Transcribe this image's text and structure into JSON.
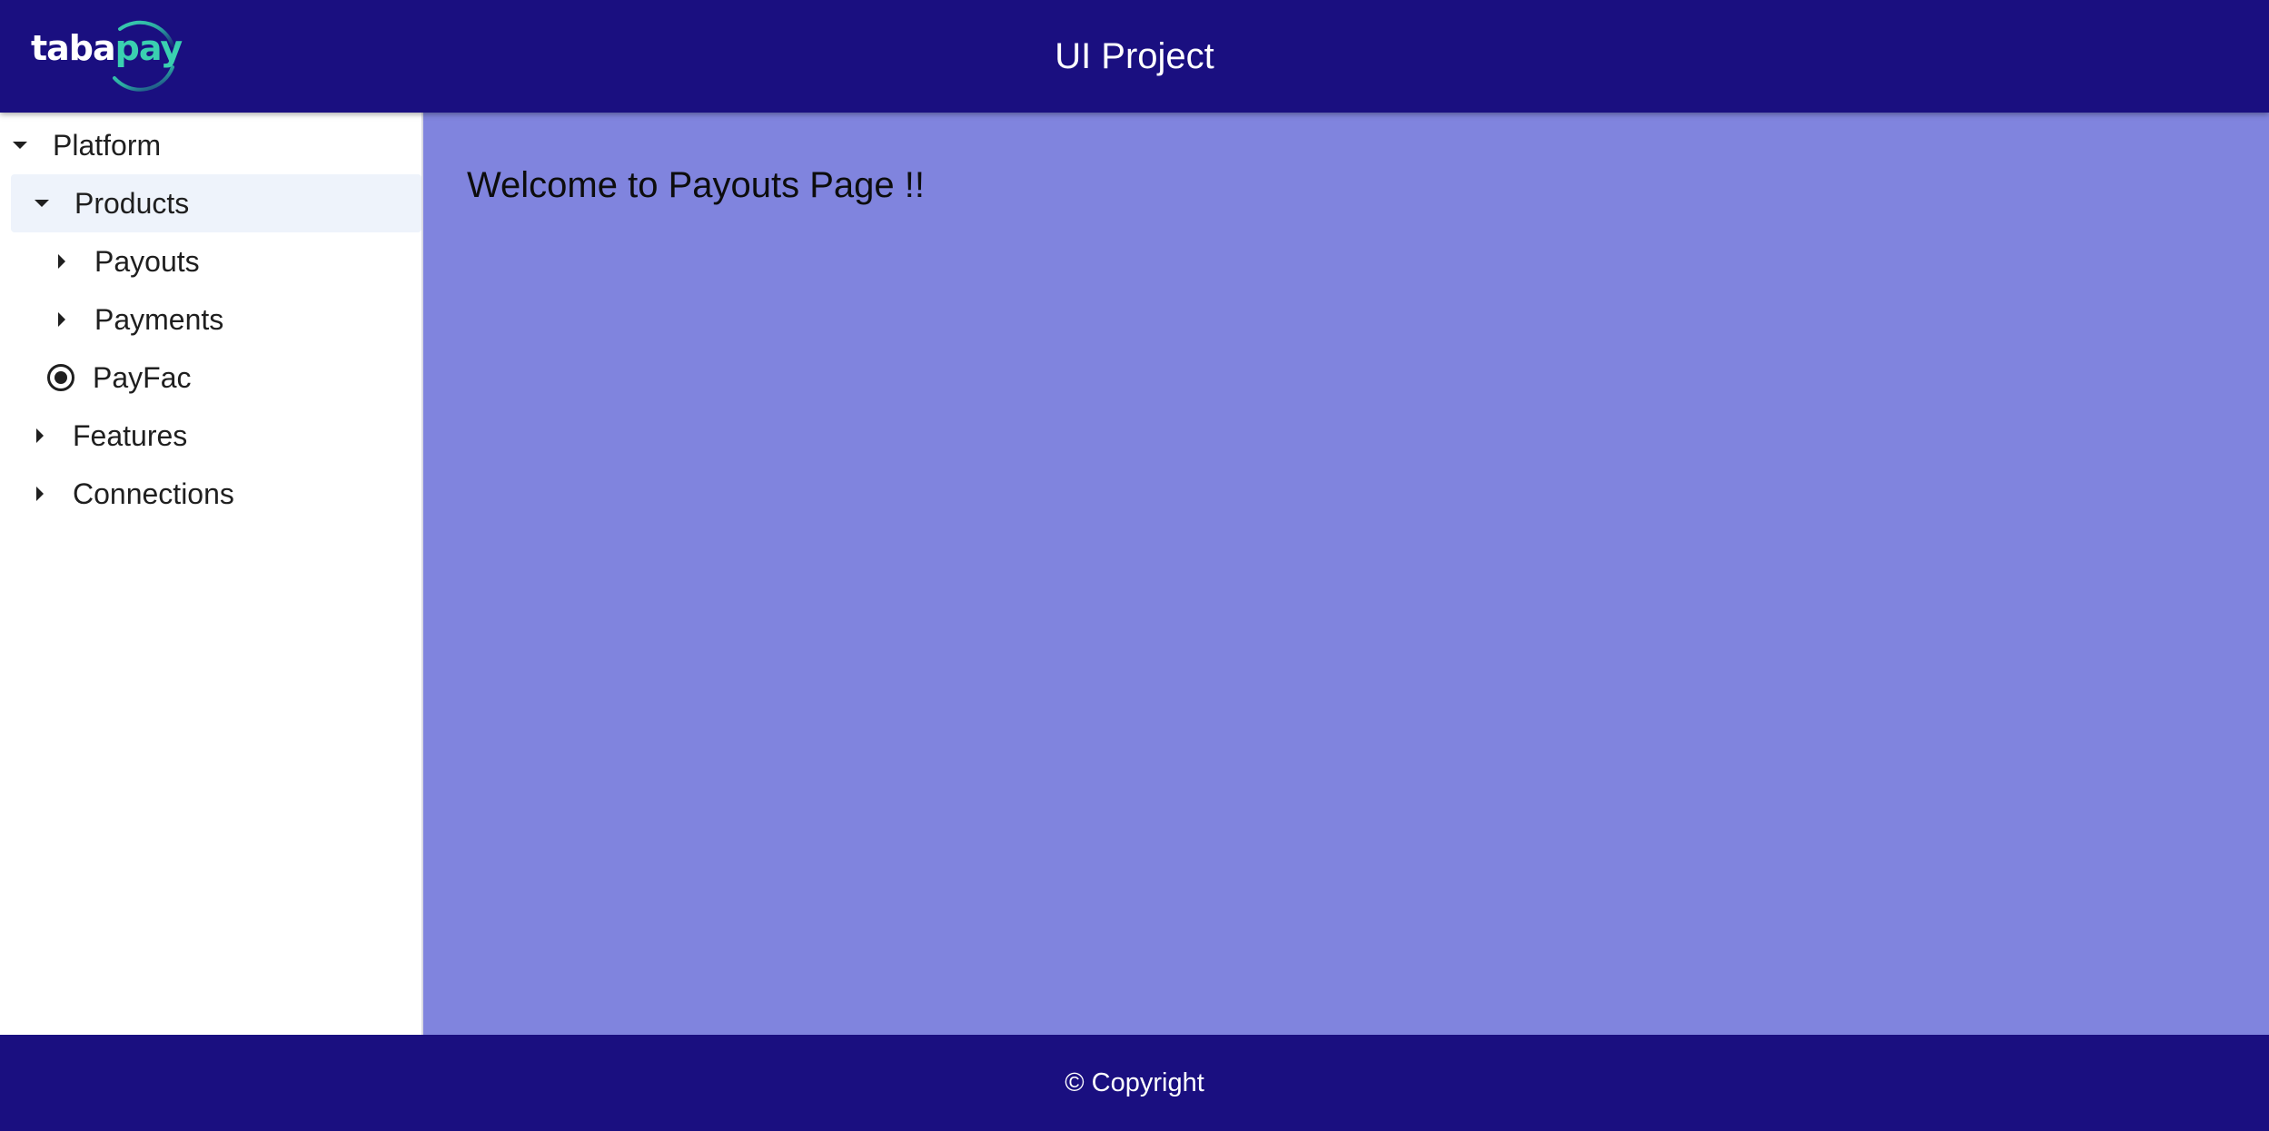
{
  "header": {
    "logo": {
      "text_main": "taba",
      "text_accent": "pay"
    },
    "title": "UI Project"
  },
  "sidebar": {
    "tree": [
      {
        "label": "Platform",
        "expanded": true,
        "level": 0
      },
      {
        "label": "Products",
        "expanded": true,
        "level": 1,
        "selected": true
      },
      {
        "label": "Payouts",
        "expanded": false,
        "level": 2
      },
      {
        "label": "Payments",
        "expanded": false,
        "level": 2
      },
      {
        "label": "PayFac",
        "level": 2,
        "type": "radio-selected"
      },
      {
        "label": "Features",
        "expanded": false,
        "level": 1
      },
      {
        "label": "Connections",
        "expanded": false,
        "level": 1
      }
    ]
  },
  "main": {
    "welcome_text": "Welcome to Payouts Page !!"
  },
  "footer": {
    "copyright": "© Copyright"
  },
  "colors": {
    "header_bg": "#1a0f80",
    "main_bg": "#8084de",
    "selected_bg": "#eef3fb",
    "logo_accent": "#3ad0b0"
  }
}
